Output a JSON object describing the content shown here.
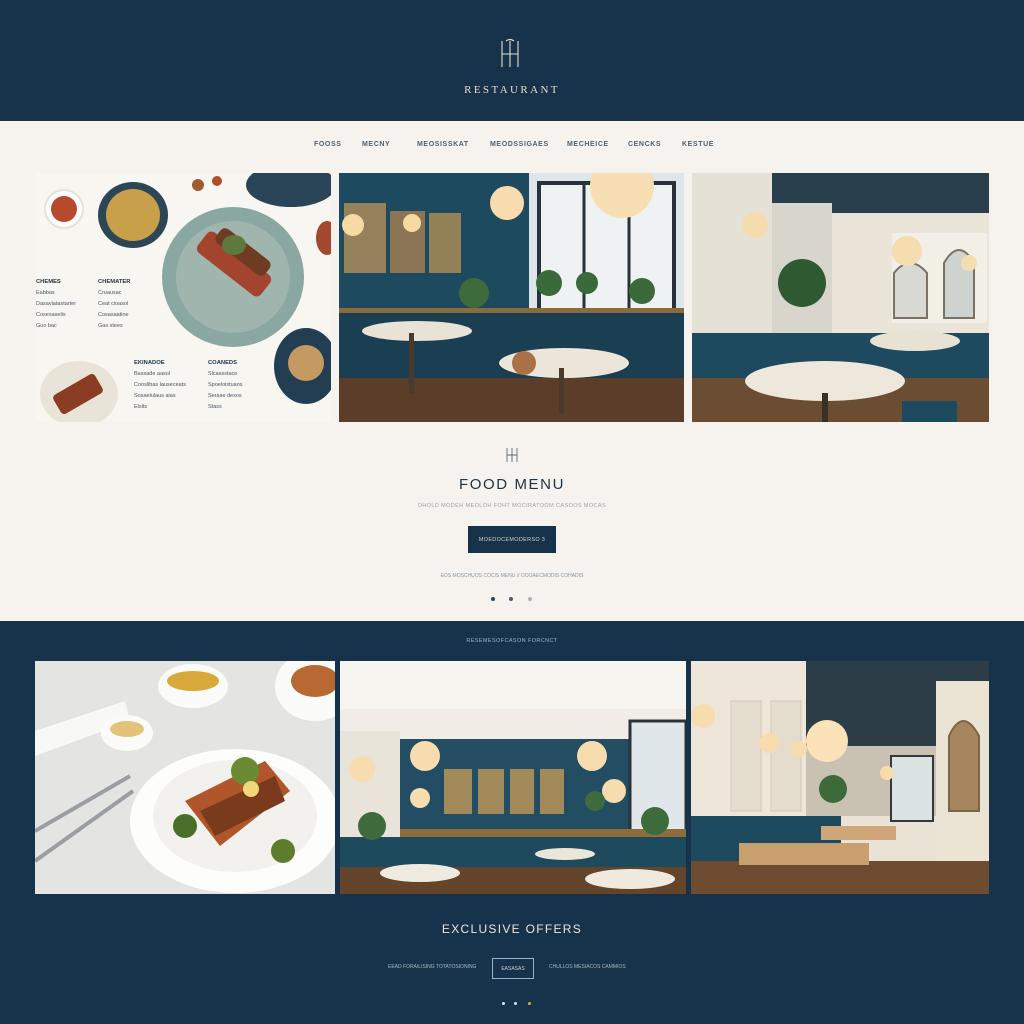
{
  "header": {
    "brand": "RESTAURANT"
  },
  "nav": {
    "items": [
      "FOOSS",
      "MECNY",
      "MEOSISSKAT",
      "MEODSSIGAES",
      "MECHEICE",
      "CENCKS",
      "KESTUE"
    ]
  },
  "menu_card": {
    "col1": {
      "heading": "CHEMES",
      "lines": [
        "Eabbas",
        "Dasaviatastarter",
        "Cosesaselis",
        "Guo bac"
      ]
    },
    "col2": {
      "heading": "CHEMATER",
      "lines": [
        "Cruausac",
        "Ceat cioasol",
        "Cosasaatine",
        "Gas stees"
      ]
    },
    "col3": {
      "heading": "EKINADOE",
      "lines": [
        "Bassade aasol",
        "Cooslibas lauseceats",
        "Sosaelulaus aias",
        "Elslts"
      ]
    },
    "col4": {
      "heading": "COANEDS",
      "lines": [
        "Slcassstace",
        "Spoeloistuaos",
        "Serase desos",
        "Stass"
      ]
    }
  },
  "food_section": {
    "title": "FOOD MENU",
    "subtitle": "DHOLD MODEH MEOLOH FOHT MOCIRATOOM CASOOS MOCAS",
    "cta_label": "MOEDOCEMODERSO 3",
    "note": "EOS MOSCHUOS COCIS MENU  //  OOOAECMODIS COHADIS"
  },
  "gallery": {
    "label": "RESEMESOFCASON FORCNCT"
  },
  "offers": {
    "title": "EXCLUSIVE OFFERS",
    "left_text": "EEAD FORAILISING TOTATOSIONING",
    "button_label": "EASASAS",
    "right_text": "CHULLOS MESIACOS CAMMIOS"
  },
  "colors": {
    "navy": "#17324b",
    "cream": "#f6f3ee",
    "teal": "#1f4a5e",
    "gold": "#e7dcc6"
  }
}
